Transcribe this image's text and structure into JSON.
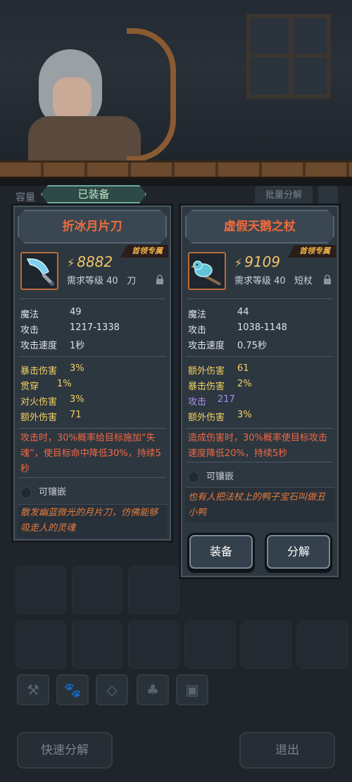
{
  "equipped_tab": "已装备",
  "capacity_label": "容量",
  "batch_decompose": "批量分解",
  "left_card": {
    "name": "折冰月片刀",
    "badge": "首领专属",
    "power": "8882",
    "requirement": "需求等级 40",
    "type": "刀",
    "base_stats": [
      {
        "label": "魔法",
        "value": "49"
      },
      {
        "label": "攻击",
        "value": "1217-1338"
      },
      {
        "label": "攻击速度",
        "value": "1秒"
      }
    ],
    "extra_stats": [
      {
        "label": "暴击伤害",
        "value": "3%"
      },
      {
        "label": "贯穿",
        "value": "1%"
      },
      {
        "label": "对火伤害",
        "value": "3%"
      },
      {
        "label": "额外伤害",
        "value": "71"
      }
    ],
    "effect": "攻击时，30%概率给目标施加“失魂”，使目标命中降低30%，持续5秒",
    "socket": "可镶嵌",
    "flavor": "散发幽蓝微光的月片刀，仿佛能够吸走人的灵魂"
  },
  "right_card": {
    "name": "虚假天鹅之杖",
    "badge": "首领专属",
    "power": "9109",
    "requirement": "需求等级 40",
    "type": "短杖",
    "base_stats": [
      {
        "label": "魔法",
        "value": "44"
      },
      {
        "label": "攻击",
        "value": "1038-1148"
      },
      {
        "label": "攻击速度",
        "value": "0.75秒"
      }
    ],
    "extra_stats": [
      {
        "label": "额外伤害",
        "value": "61"
      },
      {
        "label": "暴击伤害",
        "value": "2%"
      },
      {
        "label": "攻击",
        "value": "217"
      },
      {
        "label": "额外伤害",
        "value": "3%"
      }
    ],
    "effect": "造成伤害时，30%概率使目标攻击速度降低20%，持续5秒",
    "socket": "可镶嵌",
    "flavor": "也有人把法杖上的鸭子宝石叫做丑小鸭",
    "equip_button": "装备",
    "decompose_button": "分解"
  },
  "footer": {
    "quick_decompose": "快速分解",
    "exit": "退出"
  },
  "colors": {
    "item_name": "#ef6b3a",
    "power": "#f1c46a",
    "effect": "#f06844",
    "extra_stat": "#f1d262",
    "special_stat": "#a98ef0"
  }
}
